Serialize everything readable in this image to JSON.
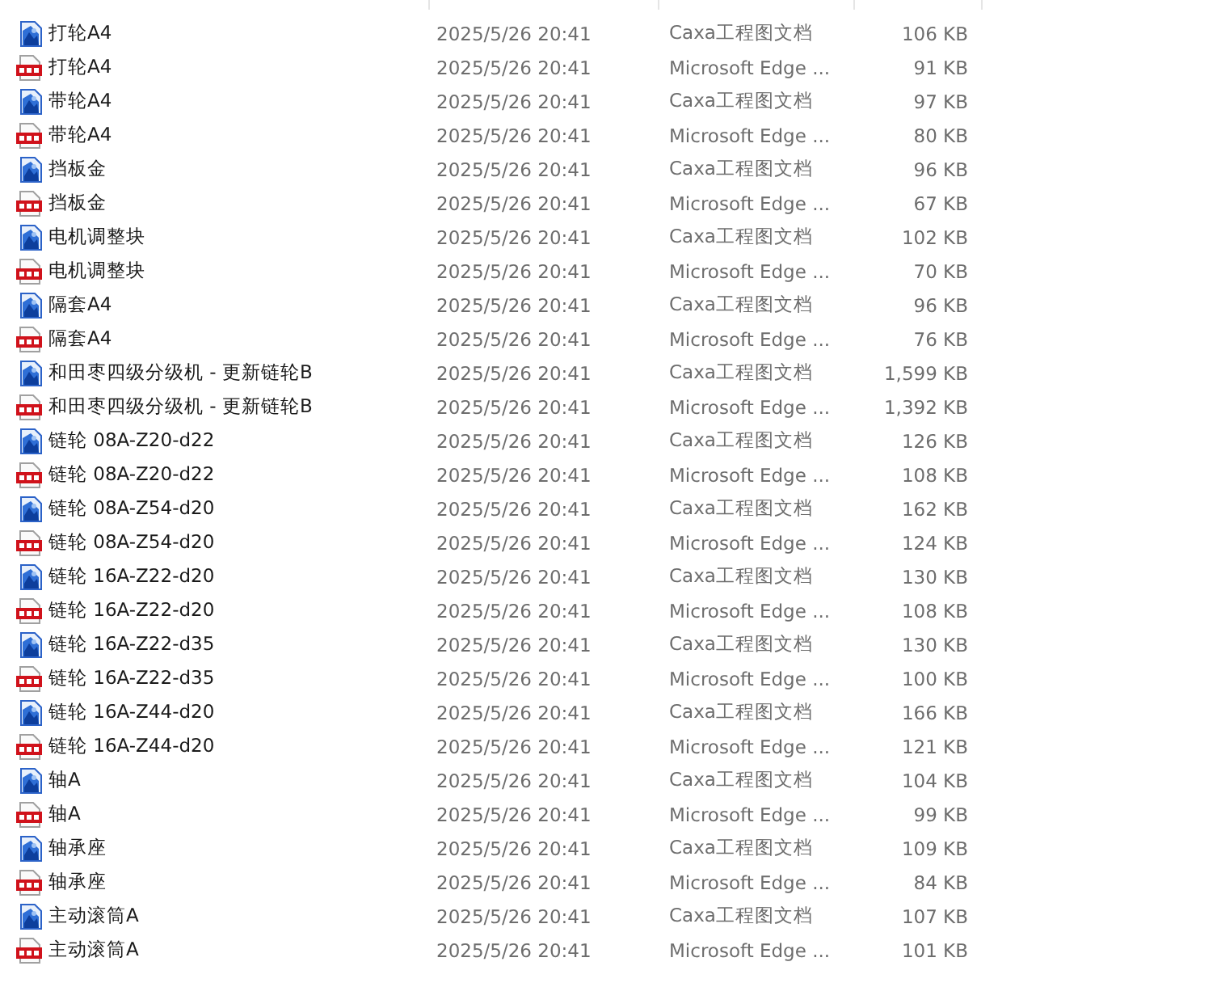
{
  "files": [
    {
      "kind": "caxa",
      "name": "打轮A4",
      "modified": "2025/5/26 20:41",
      "type": "Caxa工程图文档",
      "size": "106 KB"
    },
    {
      "kind": "pdf",
      "name": "打轮A4",
      "modified": "2025/5/26 20:41",
      "type": "Microsoft Edge ...",
      "size": "91 KB"
    },
    {
      "kind": "caxa",
      "name": "带轮A4",
      "modified": "2025/5/26 20:41",
      "type": "Caxa工程图文档",
      "size": "97 KB"
    },
    {
      "kind": "pdf",
      "name": "带轮A4",
      "modified": "2025/5/26 20:41",
      "type": "Microsoft Edge ...",
      "size": "80 KB"
    },
    {
      "kind": "caxa",
      "name": "挡板金",
      "modified": "2025/5/26 20:41",
      "type": "Caxa工程图文档",
      "size": "96 KB"
    },
    {
      "kind": "pdf",
      "name": "挡板金",
      "modified": "2025/5/26 20:41",
      "type": "Microsoft Edge ...",
      "size": "67 KB"
    },
    {
      "kind": "caxa",
      "name": "电机调整块",
      "modified": "2025/5/26 20:41",
      "type": "Caxa工程图文档",
      "size": "102 KB"
    },
    {
      "kind": "pdf",
      "name": "电机调整块",
      "modified": "2025/5/26 20:41",
      "type": "Microsoft Edge ...",
      "size": "70 KB"
    },
    {
      "kind": "caxa",
      "name": "隔套A4",
      "modified": "2025/5/26 20:41",
      "type": "Caxa工程图文档",
      "size": "96 KB"
    },
    {
      "kind": "pdf",
      "name": "隔套A4",
      "modified": "2025/5/26 20:41",
      "type": "Microsoft Edge ...",
      "size": "76 KB"
    },
    {
      "kind": "caxa",
      "name": "和田枣四级分级机 - 更新链轮B",
      "modified": "2025/5/26 20:41",
      "type": "Caxa工程图文档",
      "size": "1,599 KB"
    },
    {
      "kind": "pdf",
      "name": "和田枣四级分级机 - 更新链轮B",
      "modified": "2025/5/26 20:41",
      "type": "Microsoft Edge ...",
      "size": "1,392 KB"
    },
    {
      "kind": "caxa",
      "name": "链轮 08A-Z20-d22",
      "modified": "2025/5/26 20:41",
      "type": "Caxa工程图文档",
      "size": "126 KB"
    },
    {
      "kind": "pdf",
      "name": "链轮 08A-Z20-d22",
      "modified": "2025/5/26 20:41",
      "type": "Microsoft Edge ...",
      "size": "108 KB"
    },
    {
      "kind": "caxa",
      "name": "链轮 08A-Z54-d20",
      "modified": "2025/5/26 20:41",
      "type": "Caxa工程图文档",
      "size": "162 KB"
    },
    {
      "kind": "pdf",
      "name": "链轮 08A-Z54-d20",
      "modified": "2025/5/26 20:41",
      "type": "Microsoft Edge ...",
      "size": "124 KB"
    },
    {
      "kind": "caxa",
      "name": "链轮 16A-Z22-d20",
      "modified": "2025/5/26 20:41",
      "type": "Caxa工程图文档",
      "size": "130 KB"
    },
    {
      "kind": "pdf",
      "name": "链轮 16A-Z22-d20",
      "modified": "2025/5/26 20:41",
      "type": "Microsoft Edge ...",
      "size": "108 KB"
    },
    {
      "kind": "caxa",
      "name": "链轮 16A-Z22-d35",
      "modified": "2025/5/26 20:41",
      "type": "Caxa工程图文档",
      "size": "130 KB"
    },
    {
      "kind": "pdf",
      "name": "链轮 16A-Z22-d35",
      "modified": "2025/5/26 20:41",
      "type": "Microsoft Edge ...",
      "size": "100 KB"
    },
    {
      "kind": "caxa",
      "name": "链轮 16A-Z44-d20",
      "modified": "2025/5/26 20:41",
      "type": "Caxa工程图文档",
      "size": "166 KB"
    },
    {
      "kind": "pdf",
      "name": "链轮 16A-Z44-d20",
      "modified": "2025/5/26 20:41",
      "type": "Microsoft Edge ...",
      "size": "121 KB"
    },
    {
      "kind": "caxa",
      "name": "轴A",
      "modified": "2025/5/26 20:41",
      "type": "Caxa工程图文档",
      "size": "104 KB"
    },
    {
      "kind": "pdf",
      "name": "轴A",
      "modified": "2025/5/26 20:41",
      "type": "Microsoft Edge ...",
      "size": "99 KB"
    },
    {
      "kind": "caxa",
      "name": "轴承座",
      "modified": "2025/5/26 20:41",
      "type": "Caxa工程图文档",
      "size": "109 KB"
    },
    {
      "kind": "pdf",
      "name": "轴承座",
      "modified": "2025/5/26 20:41",
      "type": "Microsoft Edge ...",
      "size": "84 KB"
    },
    {
      "kind": "caxa",
      "name": "主动滚筒A",
      "modified": "2025/5/26 20:41",
      "type": "Caxa工程图文档",
      "size": "107 KB"
    },
    {
      "kind": "pdf",
      "name": "主动滚筒A",
      "modified": "2025/5/26 20:41",
      "type": "Microsoft Edge ...",
      "size": "101 KB"
    }
  ]
}
